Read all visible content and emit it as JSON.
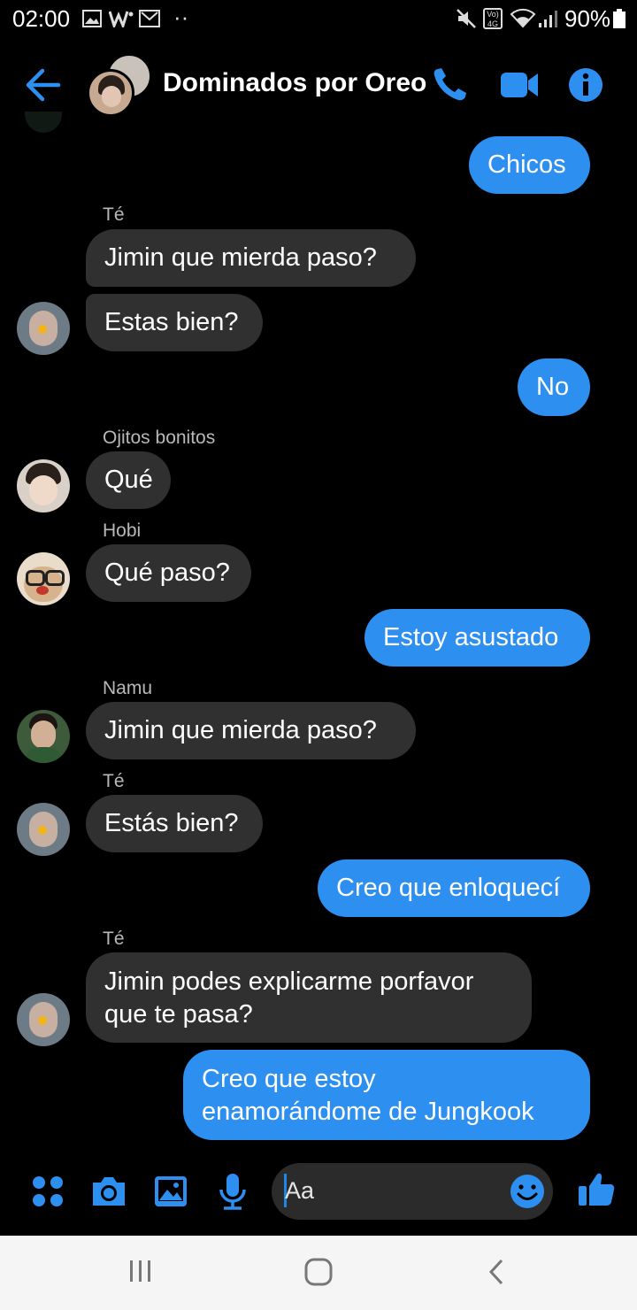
{
  "status_bar": {
    "time": "02:00",
    "battery": "90%",
    "dots": "··",
    "volte": "Vo) 4G"
  },
  "header": {
    "title": "Dominados por Oreo"
  },
  "colors": {
    "accent": "#2d8ff0",
    "incoming_bubble": "#303030",
    "background": "#000000"
  },
  "messages": [
    {
      "direction": "out",
      "text": "Chicos"
    },
    {
      "direction": "in",
      "sender": "Té",
      "text": "Jimin que mierda paso?"
    },
    {
      "direction": "in",
      "text": "Estas bien?"
    },
    {
      "direction": "out",
      "text": "No"
    },
    {
      "direction": "in",
      "sender": "Ojitos bonitos",
      "text": "Qué"
    },
    {
      "direction": "in",
      "sender": "Hobi",
      "text": "Qué paso?"
    },
    {
      "direction": "out",
      "text": "Estoy asustado"
    },
    {
      "direction": "in",
      "sender": "Namu",
      "text": "Jimin que mierda paso?"
    },
    {
      "direction": "in",
      "sender": "Té",
      "text": "Estás bien?"
    },
    {
      "direction": "out",
      "text": "Creo que enloquecí"
    },
    {
      "direction": "in",
      "sender": "Té",
      "line1": "Jimin podes explicarme porfavor",
      "line2": "que te pasa?"
    },
    {
      "direction": "out",
      "line1": "Creo que estoy",
      "line2": "enamorándome de Jungkook"
    }
  ],
  "composer": {
    "placeholder": "Aa"
  },
  "icons": {
    "header": [
      "back-arrow-icon",
      "phone-icon",
      "video-camera-icon",
      "info-icon"
    ],
    "composer": [
      "apps-icon",
      "camera-icon",
      "gallery-icon",
      "microphone-icon",
      "emoji-icon",
      "thumbs-up-icon"
    ],
    "navbar": [
      "recent-apps-icon",
      "home-icon",
      "back-icon"
    ]
  }
}
